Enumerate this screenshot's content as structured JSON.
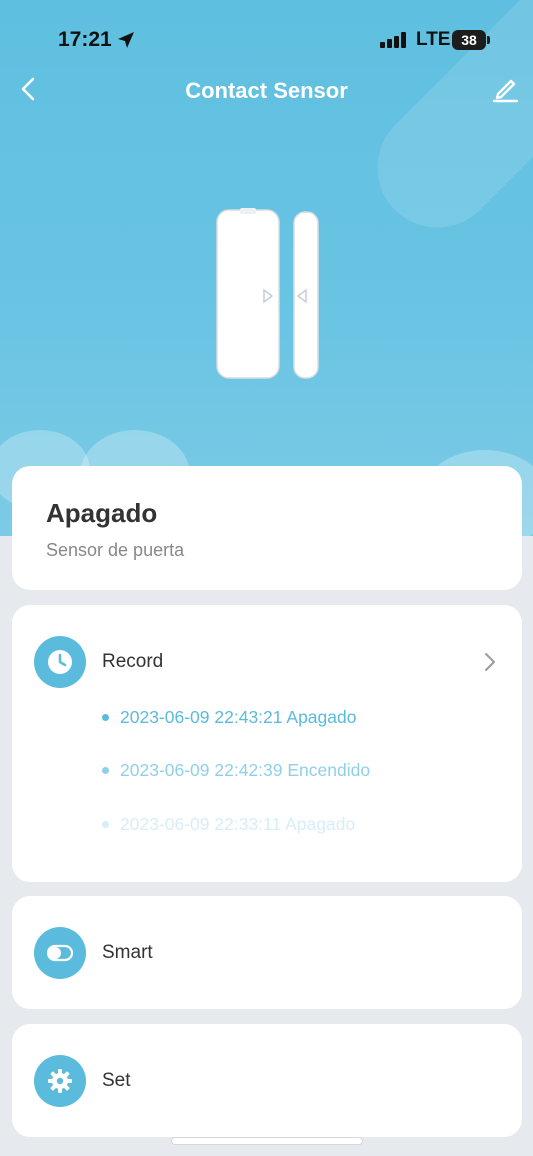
{
  "status_bar": {
    "time": "17:21",
    "network": "LTE",
    "battery": "38"
  },
  "nav": {
    "title": "Contact Sensor"
  },
  "device_status": {
    "state": "Apagado",
    "description": "Sensor de puerta"
  },
  "record": {
    "label": "Record",
    "entries": [
      {
        "text": "2023-06-09 22:43:21 Apagado"
      },
      {
        "text": "2023-06-09 22:42:39 Encendido"
      },
      {
        "text": "2023-06-09 22:33:11 Apagado"
      }
    ]
  },
  "smart": {
    "label": "Smart"
  },
  "settings": {
    "label": "Set"
  },
  "colors": {
    "accent": "#5bbbdc",
    "hero_background": "#5fbfe0",
    "card_background": "#ffffff",
    "page_background": "#e6e9ed"
  },
  "icons": {
    "back": "chevron-left-icon",
    "edit": "pencil-icon",
    "record": "clock-icon",
    "smart": "toggle-icon",
    "settings": "gear-icon",
    "record_more": "chevron-right-icon"
  }
}
